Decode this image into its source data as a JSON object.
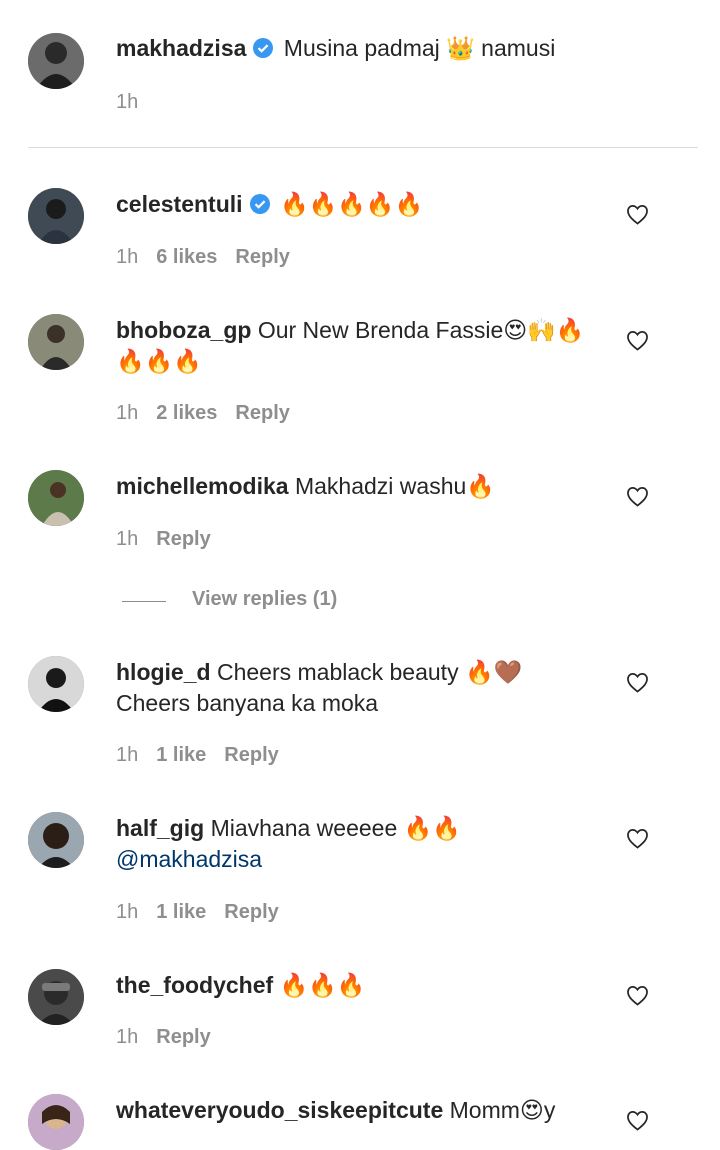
{
  "caption": {
    "username": "makhadzisa",
    "verified": true,
    "text": "Musina padmaj 👑 namusi",
    "time": "1h"
  },
  "comments": [
    {
      "username": "celestentuli",
      "verified": true,
      "line1": "🔥🔥🔥🔥🔥",
      "line2": "",
      "time": "1h",
      "likes": "6 likes",
      "reply": "Reply"
    },
    {
      "username": "bhoboza_gp",
      "verified": false,
      "line1": "Our New Brenda Fassie😍🙌🔥",
      "line2": "🔥🔥🔥",
      "time": "1h",
      "likes": "2 likes",
      "reply": "Reply"
    },
    {
      "username": "michellemodika",
      "verified": false,
      "line1": "Makhadzi washu🔥",
      "line2": "",
      "time": "1h",
      "likes": "",
      "reply": "Reply"
    },
    {
      "username": "hlogie_d",
      "verified": false,
      "line1": "Cheers mablack beauty 🔥🤎",
      "line2": "Cheers banyana ka moka",
      "time": "1h",
      "likes": "1 like",
      "reply": "Reply"
    },
    {
      "username": "half_gig",
      "verified": false,
      "line1": "Miavhana weeeee 🔥🔥",
      "line2": "@makhadzisa",
      "time": "1h",
      "likes": "1 like",
      "reply": "Reply"
    },
    {
      "username": "the_foodychef",
      "verified": false,
      "line1": "🔥🔥🔥",
      "line2": "",
      "time": "1h",
      "likes": "",
      "reply": "Reply"
    },
    {
      "username": "whateveryoudo_siskeepitcute",
      "verified": false,
      "line1": "Momm😍y",
      "line2": "",
      "time": "",
      "likes": "",
      "reply": ""
    }
  ],
  "view_replies": "View replies (1)",
  "colors": {
    "verified": "#3897f0",
    "mention": "#00376b",
    "meta": "#8e8e8e"
  }
}
